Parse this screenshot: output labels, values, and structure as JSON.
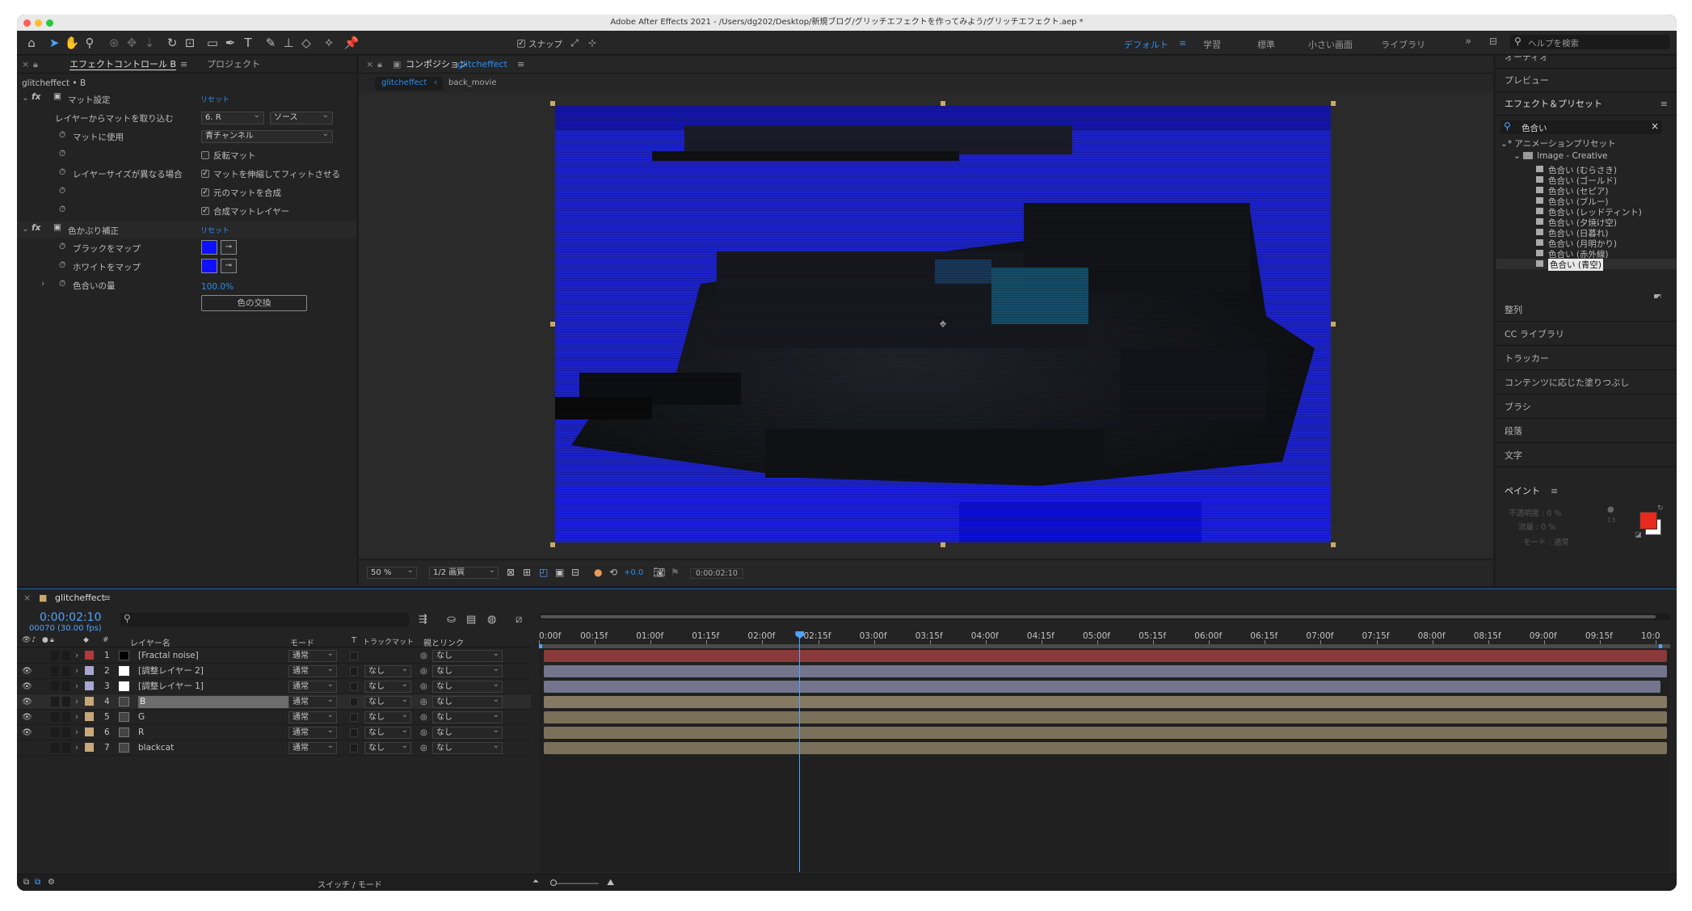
{
  "titlebar": {
    "title": "Adobe After Effects 2021 - /Users/dg202/Desktop/新規ブログ/グリッチエフェクトを作ってみよう/グリッチエフェクト.aep *"
  },
  "toolbar": {
    "snap_label": "スナップ",
    "workspaces": [
      "デフォルト",
      "学習",
      "標準",
      "小さい画面",
      "ライブラリ"
    ],
    "help_placeholder": "ヘルプを検索"
  },
  "effect_controls": {
    "tab_label": "エフェクトコントロール B",
    "project_tab": "プロジェクト",
    "layer_path": "glitcheffect • B",
    "effect1": {
      "name": "マット設定",
      "reset": "リセット",
      "take_matte_label": "レイヤーからマットを取り込む",
      "take_matte_value": "6. R",
      "source_value": "ソース",
      "use_matte_label": "マットに使用",
      "use_matte_value": "青チャンネル",
      "invert_label": "反転マット",
      "size_label": "レイヤーサイズが異なる場合",
      "stretch_label": "マットを伸縮してフィットさせる",
      "composite_label": "元のマットを合成",
      "premultiply_label": "合成マットレイヤー"
    },
    "effect2": {
      "name": "色かぶり補正",
      "reset": "リセット",
      "map_black_label": "ブラックをマップ",
      "map_white_label": "ホワイトをマップ",
      "amount_label": "色合いの量",
      "amount_value": "100.0%",
      "swap_button": "色の交換"
    }
  },
  "composition": {
    "panel_label": "コンポジション",
    "comp_name": "glitcheffect",
    "breadcrumb": [
      "glitcheffect",
      "back_movie"
    ],
    "zoom": "50 %",
    "resolution": "1/2 画質",
    "exposure": "+0.0",
    "timecode": "0:00:02:10"
  },
  "sidebar": {
    "panels": [
      "オーディオ",
      "プレビュー",
      "エフェクト＆プリセット"
    ],
    "search_value": "色合い",
    "tree_root": "* アニメーションプリセット",
    "tree_folder": "Image - Creative",
    "presets": [
      "色合い (むらさき)",
      "色合い (ゴールド)",
      "色合い (セピア)",
      "色合い (ブルー)",
      "色合い (レッドティント)",
      "色合い (夕焼け空)",
      "色合い (日暮れ)",
      "色合い (月明かり)",
      "色合い (赤外線)",
      "色合い (青空)"
    ],
    "lower_panels": [
      "整列",
      "CC ライブラリ",
      "トラッカー",
      "コンテンツに応じた塗りつぶし",
      "ブラシ",
      "段落",
      "文字"
    ],
    "paint": {
      "title": "ペイント",
      "opacity_label": "不透明度 : 0 %",
      "flow_label": "流量 : 0 %",
      "mode_label": "モード : 通常",
      "brush_size": "13"
    }
  },
  "timeline": {
    "tab": "glitcheffect",
    "timecode": "0:00:02:10",
    "frame_info": "00070 (30.00 fps)",
    "headers": {
      "num": "#",
      "layer_name": "レイヤー名",
      "mode": "モード",
      "t": "T",
      "trackmatte": "トラックマット",
      "parent": "親とリンク"
    },
    "ruler": [
      "0:00f",
      "00:15f",
      "01:00f",
      "01:15f",
      "02:00f",
      "02:15f",
      "03:00f",
      "03:15f",
      "04:00f",
      "04:15f",
      "05:00f",
      "05:15f",
      "06:00f",
      "06:15f",
      "07:00f",
      "07:15f",
      "08:00f",
      "08:15f",
      "09:00f",
      "09:15f",
      "10:0"
    ],
    "playhead_seconds": 2.333,
    "duration_seconds": 10,
    "layers": [
      {
        "num": "1",
        "name": "[Fractal noise]",
        "mode": "通常",
        "matte": "",
        "parent": "なし",
        "label_color": "#b33838",
        "bar_color": "#8a3a3a",
        "visible": false
      },
      {
        "num": "2",
        "name": "[調整レイヤー 2]",
        "mode": "通常",
        "matte": "なし",
        "parent": "なし",
        "label_color": "#a9a5d2",
        "bar_color": "#74748c",
        "visible": true
      },
      {
        "num": "3",
        "name": "[調整レイヤー 1]",
        "mode": "通常",
        "matte": "なし",
        "parent": "なし",
        "label_color": "#a9a5d2",
        "bar_color": "#74748c",
        "visible": true
      },
      {
        "num": "4",
        "name": "B",
        "mode": "通常",
        "matte": "なし",
        "parent": "なし",
        "label_color": "#c7a77c",
        "bar_color": "#857a61",
        "visible": true
      },
      {
        "num": "5",
        "name": "G",
        "mode": "通常",
        "matte": "なし",
        "parent": "なし",
        "label_color": "#c7a77c",
        "bar_color": "#7b705a",
        "visible": true
      },
      {
        "num": "6",
        "name": "R",
        "mode": "通常",
        "matte": "なし",
        "parent": "なし",
        "label_color": "#c7a77c",
        "bar_color": "#7b705a",
        "visible": true
      },
      {
        "num": "7",
        "name": "blackcat",
        "mode": "通常",
        "matte": "なし",
        "parent": "なし",
        "label_color": "#c7a77c",
        "bar_color": "#7b705a",
        "visible": false
      }
    ],
    "footer_label": "スイッチ / モード"
  }
}
